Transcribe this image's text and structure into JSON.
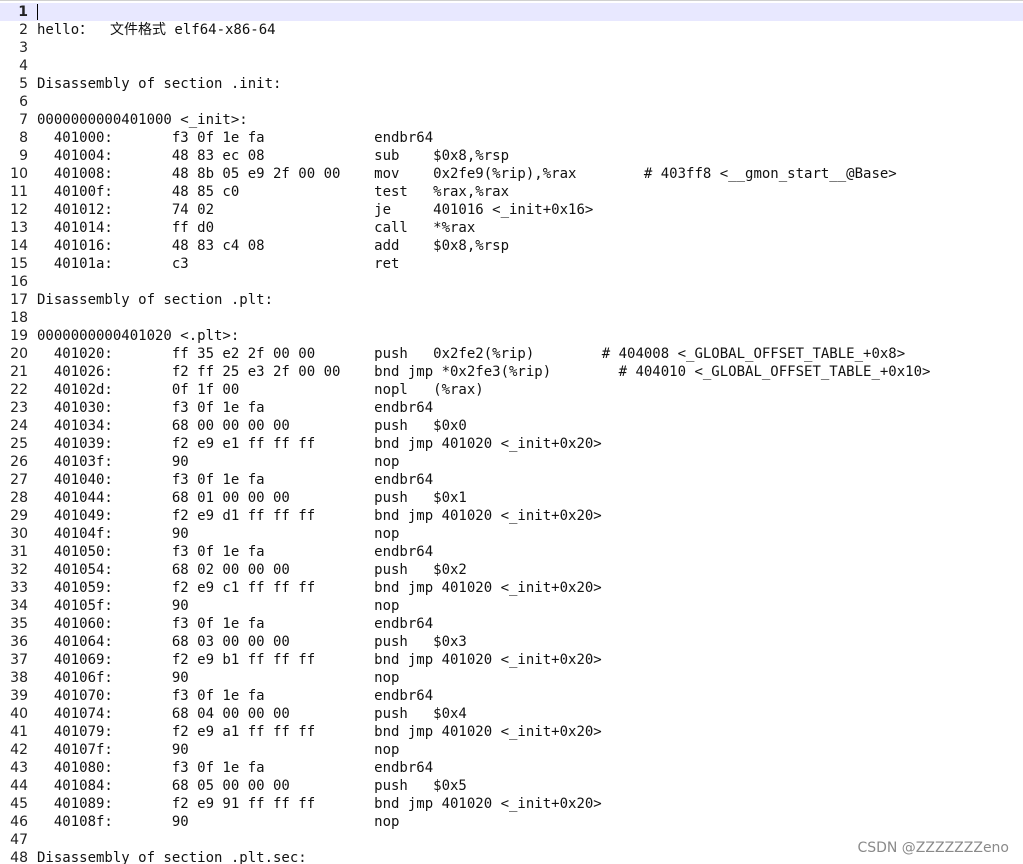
{
  "editor": {
    "current_line": 1,
    "lines": [
      {
        "n": "1",
        "text": ""
      },
      {
        "n": "2",
        "text": "hello：  文件格式 elf64-x86-64"
      },
      {
        "n": "3",
        "text": ""
      },
      {
        "n": "4",
        "text": ""
      },
      {
        "n": "5",
        "text": "Disassembly of section .init:"
      },
      {
        "n": "6",
        "text": ""
      },
      {
        "n": "7",
        "text": "0000000000401000 <_init>:"
      },
      {
        "n": "8",
        "text": "  401000:       f3 0f 1e fa             endbr64"
      },
      {
        "n": "9",
        "text": "  401004:       48 83 ec 08             sub    $0x8,%rsp"
      },
      {
        "n": "10",
        "text": "  401008:       48 8b 05 e9 2f 00 00    mov    0x2fe9(%rip),%rax        # 403ff8 <__gmon_start__@Base>"
      },
      {
        "n": "11",
        "text": "  40100f:       48 85 c0                test   %rax,%rax"
      },
      {
        "n": "12",
        "text": "  401012:       74 02                   je     401016 <_init+0x16>"
      },
      {
        "n": "13",
        "text": "  401014:       ff d0                   call   *%rax"
      },
      {
        "n": "14",
        "text": "  401016:       48 83 c4 08             add    $0x8,%rsp"
      },
      {
        "n": "15",
        "text": "  40101a:       c3                      ret"
      },
      {
        "n": "16",
        "text": ""
      },
      {
        "n": "17",
        "text": "Disassembly of section .plt:"
      },
      {
        "n": "18",
        "text": ""
      },
      {
        "n": "19",
        "text": "0000000000401020 <.plt>:"
      },
      {
        "n": "20",
        "text": "  401020:       ff 35 e2 2f 00 00       push   0x2fe2(%rip)        # 404008 <_GLOBAL_OFFSET_TABLE_+0x8>"
      },
      {
        "n": "21",
        "text": "  401026:       f2 ff 25 e3 2f 00 00    bnd jmp *0x2fe3(%rip)        # 404010 <_GLOBAL_OFFSET_TABLE_+0x10>"
      },
      {
        "n": "22",
        "text": "  40102d:       0f 1f 00                nopl   (%rax)"
      },
      {
        "n": "23",
        "text": "  401030:       f3 0f 1e fa             endbr64"
      },
      {
        "n": "24",
        "text": "  401034:       68 00 00 00 00          push   $0x0"
      },
      {
        "n": "25",
        "text": "  401039:       f2 e9 e1 ff ff ff       bnd jmp 401020 <_init+0x20>"
      },
      {
        "n": "26",
        "text": "  40103f:       90                      nop"
      },
      {
        "n": "27",
        "text": "  401040:       f3 0f 1e fa             endbr64"
      },
      {
        "n": "28",
        "text": "  401044:       68 01 00 00 00          push   $0x1"
      },
      {
        "n": "29",
        "text": "  401049:       f2 e9 d1 ff ff ff       bnd jmp 401020 <_init+0x20>"
      },
      {
        "n": "30",
        "text": "  40104f:       90                      nop"
      },
      {
        "n": "31",
        "text": "  401050:       f3 0f 1e fa             endbr64"
      },
      {
        "n": "32",
        "text": "  401054:       68 02 00 00 00          push   $0x2"
      },
      {
        "n": "33",
        "text": "  401059:       f2 e9 c1 ff ff ff       bnd jmp 401020 <_init+0x20>"
      },
      {
        "n": "34",
        "text": "  40105f:       90                      nop"
      },
      {
        "n": "35",
        "text": "  401060:       f3 0f 1e fa             endbr64"
      },
      {
        "n": "36",
        "text": "  401064:       68 03 00 00 00          push   $0x3"
      },
      {
        "n": "37",
        "text": "  401069:       f2 e9 b1 ff ff ff       bnd jmp 401020 <_init+0x20>"
      },
      {
        "n": "38",
        "text": "  40106f:       90                      nop"
      },
      {
        "n": "39",
        "text": "  401070:       f3 0f 1e fa             endbr64"
      },
      {
        "n": "40",
        "text": "  401074:       68 04 00 00 00          push   $0x4"
      },
      {
        "n": "41",
        "text": "  401079:       f2 e9 a1 ff ff ff       bnd jmp 401020 <_init+0x20>"
      },
      {
        "n": "42",
        "text": "  40107f:       90                      nop"
      },
      {
        "n": "43",
        "text": "  401080:       f3 0f 1e fa             endbr64"
      },
      {
        "n": "44",
        "text": "  401084:       68 05 00 00 00          push   $0x5"
      },
      {
        "n": "45",
        "text": "  401089:       f2 e9 91 ff ff ff       bnd jmp 401020 <_init+0x20>"
      },
      {
        "n": "46",
        "text": "  40108f:       90                      nop"
      },
      {
        "n": "47",
        "text": ""
      },
      {
        "n": "48",
        "text": "Disassembly of section .plt.sec:"
      }
    ]
  },
  "watermark": "CSDN @ZZZZZZZeno",
  "colors": {
    "current_line_highlight": "#e8e8ff",
    "watermark": "#8a8a8a"
  }
}
